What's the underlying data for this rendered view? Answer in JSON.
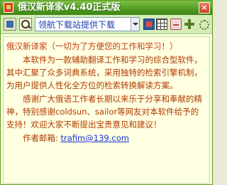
{
  "window": {
    "title": "俄汉新译家v4.40正式版",
    "close_glyph": "×"
  },
  "toolbar": {
    "search_value": "领航下载站提供下载",
    "icons": [
      "book-icon",
      "search-icon",
      "dropdown-arrow-icon",
      "dictionary-icon",
      "table-icon",
      "clear-icon",
      "navigate-icon",
      "move-icon"
    ]
  },
  "content": {
    "heading": "俄汉新译家（一切为了方便您的工作和学习！）",
    "paragraph1": "本软件为一款辅助翻译工作和学习的综合型软件，其中汇聚了众多词典系统，采用独特的检索引擎机制，为用户提供人性化全方位的检索转换解读方案。",
    "paragraph2": "感谢广大俄语工作者长期以来乐于分享和奉献的精神，特别感谢coldsun、sailor等网友对本软件给予的支持！欢迎大家不断提出宝贵意见和建议！",
    "author_label": "作者邮箱:",
    "author_email": "trafim@139.com"
  },
  "colors": {
    "title_green": "#4f9a1f",
    "toolbar_green": "#d4ecb8",
    "content_bg": "#ffffe1",
    "text_red": "#b03a00",
    "link_blue": "#1a35d4"
  }
}
